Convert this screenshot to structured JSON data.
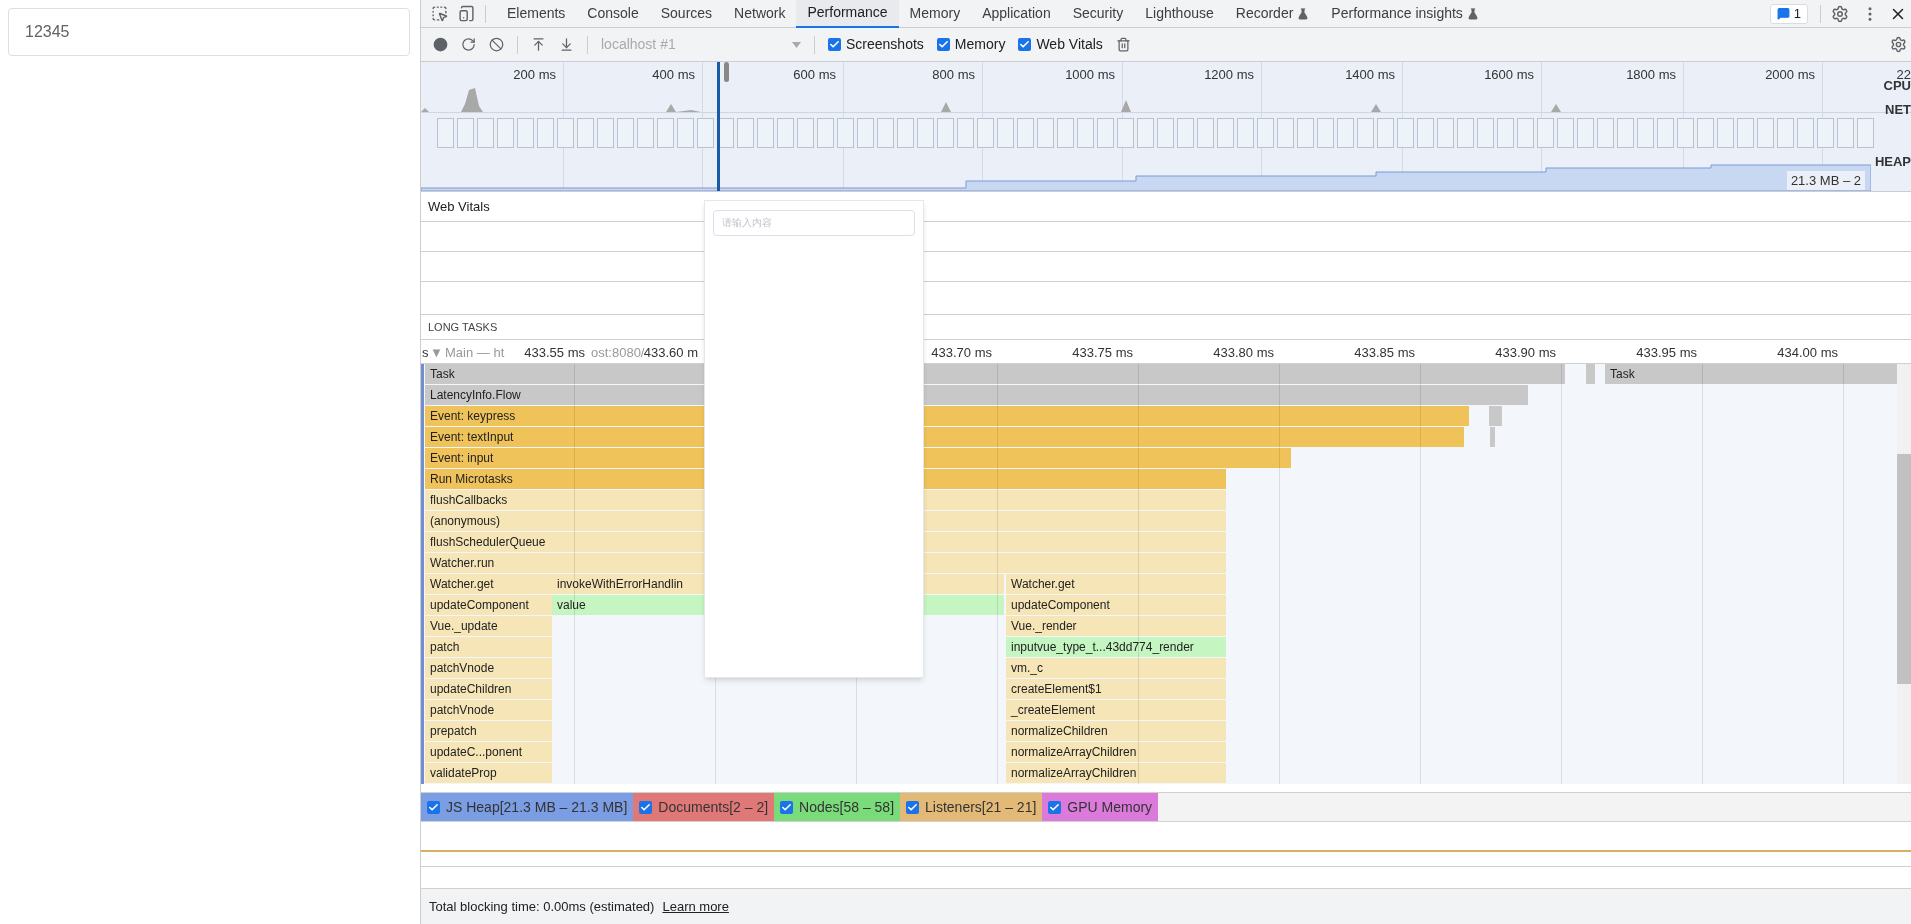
{
  "page": {
    "input_value": "12345"
  },
  "devtools": {
    "tabs": [
      {
        "label": "Elements",
        "selected": false,
        "experimental": false
      },
      {
        "label": "Console",
        "selected": false,
        "experimental": false
      },
      {
        "label": "Sources",
        "selected": false,
        "experimental": false
      },
      {
        "label": "Network",
        "selected": false,
        "experimental": false
      },
      {
        "label": "Performance",
        "selected": true,
        "experimental": false
      },
      {
        "label": "Memory",
        "selected": false,
        "experimental": false
      },
      {
        "label": "Application",
        "selected": false,
        "experimental": false
      },
      {
        "label": "Security",
        "selected": false,
        "experimental": false
      },
      {
        "label": "Lighthouse",
        "selected": false,
        "experimental": false
      },
      {
        "label": "Recorder",
        "selected": false,
        "experimental": true
      },
      {
        "label": "Performance insights",
        "selected": false,
        "experimental": true
      }
    ],
    "issues_count": "1",
    "toolbar": {
      "profile_select": "localhost #1",
      "checkboxes": [
        {
          "label": "Screenshots",
          "checked": true
        },
        {
          "label": "Memory",
          "checked": true
        },
        {
          "label": "Web Vitals",
          "checked": true
        }
      ]
    },
    "overview": {
      "time_labels": [
        "200 ms",
        "400 ms",
        "600 ms",
        "800 ms",
        "1000 ms",
        "1200 ms",
        "1400 ms",
        "1600 ms",
        "1800 ms",
        "2000 ms",
        "22"
      ],
      "track_labels": [
        "CPU",
        "NET",
        "HEAP"
      ],
      "heap_range": "21.3 MB – 2"
    },
    "web_vitals": {
      "title": "Web Vitals"
    },
    "long_tasks": {
      "title": "LONG TASKS"
    },
    "flame_chart": {
      "cut_prefix": "s",
      "expand_glyph": "▼",
      "track_label": "Main — ht",
      "track_label_tail": "ost:8080/",
      "ruler": [
        "433.55 ms",
        "433.60 m",
        "433.70 ms",
        "433.75 ms",
        "433.80 ms",
        "433.85 ms",
        "433.90 ms",
        "433.95 ms",
        "434.00 ms"
      ],
      "rows": [
        {
          "entries": [
            {
              "label": "Task",
              "kind": "task"
            },
            {
              "kind": "task"
            },
            {
              "label": "Task",
              "kind": "task"
            }
          ]
        },
        {
          "entries": [
            {
              "label": "LatencyInfo.Flow",
              "kind": "task"
            }
          ]
        },
        {
          "entries": [
            {
              "label": "Event: keypress",
              "kind": "event"
            },
            {
              "kind": "task"
            }
          ]
        },
        {
          "entries": [
            {
              "label": "Event: textInput",
              "kind": "event"
            },
            {
              "kind": "task"
            }
          ]
        },
        {
          "entries": [
            {
              "label": "Event: input",
              "kind": "event"
            }
          ]
        },
        {
          "entries": [
            {
              "label": "Run Microtasks",
              "kind": "event"
            }
          ]
        },
        {
          "entries": [
            {
              "label": "flushCallbacks",
              "kind": "script"
            }
          ]
        },
        {
          "entries": [
            {
              "label": "(anonymous)",
              "kind": "script"
            }
          ]
        },
        {
          "entries": [
            {
              "label": "flushSchedulerQueue",
              "kind": "script"
            }
          ]
        },
        {
          "entries": [
            {
              "label": "Watcher.run",
              "kind": "script"
            }
          ]
        },
        {
          "entries": [
            {
              "label": "Watcher.get",
              "kind": "script"
            },
            {
              "label": "invokeWithErrorHandlin",
              "kind": "script"
            },
            {
              "label": "Watcher.get",
              "kind": "script"
            }
          ]
        },
        {
          "entries": [
            {
              "label": "updateComponent",
              "kind": "script"
            },
            {
              "label": "value",
              "kind": "code"
            },
            {
              "label": "updateComponent",
              "kind": "script"
            }
          ]
        },
        {
          "entries": [
            {
              "label": "Vue._update",
              "kind": "script"
            },
            {
              "label": "Vue._render",
              "kind": "script"
            }
          ]
        },
        {
          "entries": [
            {
              "label": "patch",
              "kind": "script"
            },
            {
              "label": "inputvue_type_t...43dd774_render",
              "kind": "code"
            }
          ]
        },
        {
          "entries": [
            {
              "label": "patchVnode",
              "kind": "script"
            },
            {
              "label": "vm._c",
              "kind": "script"
            }
          ]
        },
        {
          "entries": [
            {
              "label": "updateChildren",
              "kind": "script"
            },
            {
              "label": "createElement$1",
              "kind": "script"
            }
          ]
        },
        {
          "entries": [
            {
              "label": "patchVnode",
              "kind": "script"
            },
            {
              "label": "_createElement",
              "kind": "script"
            }
          ]
        },
        {
          "entries": [
            {
              "label": "prepatch",
              "kind": "script"
            },
            {
              "label": "normalizeChildren",
              "kind": "script"
            }
          ]
        },
        {
          "entries": [
            {
              "label": "updateC...ponent",
              "kind": "script"
            },
            {
              "label": "normalizeArrayChildren",
              "kind": "script"
            }
          ]
        },
        {
          "entries": [
            {
              "label": "validateProp",
              "kind": "script"
            },
            {
              "label": "normalizeArrayChildren",
              "kind": "script"
            }
          ]
        }
      ]
    },
    "counters": [
      {
        "label": "JS Heap[21.3 MB – 21.3 MB]",
        "checked": true,
        "color": "#7b9de3"
      },
      {
        "label": "Documents[2 – 2]",
        "checked": true,
        "color": "#e07878"
      },
      {
        "label": "Nodes[58 – 58]",
        "checked": true,
        "color": "#7adb7a"
      },
      {
        "label": "Listeners[21 – 21]",
        "checked": true,
        "color": "#e3b978"
      },
      {
        "label": "GPU Memory",
        "checked": true,
        "color": "#dc7adc"
      }
    ],
    "popup": {
      "placeholder": "请输入内容"
    },
    "footer": {
      "text": "Total blocking time: 0.00ms (estimated)",
      "link": "Learn more"
    }
  }
}
